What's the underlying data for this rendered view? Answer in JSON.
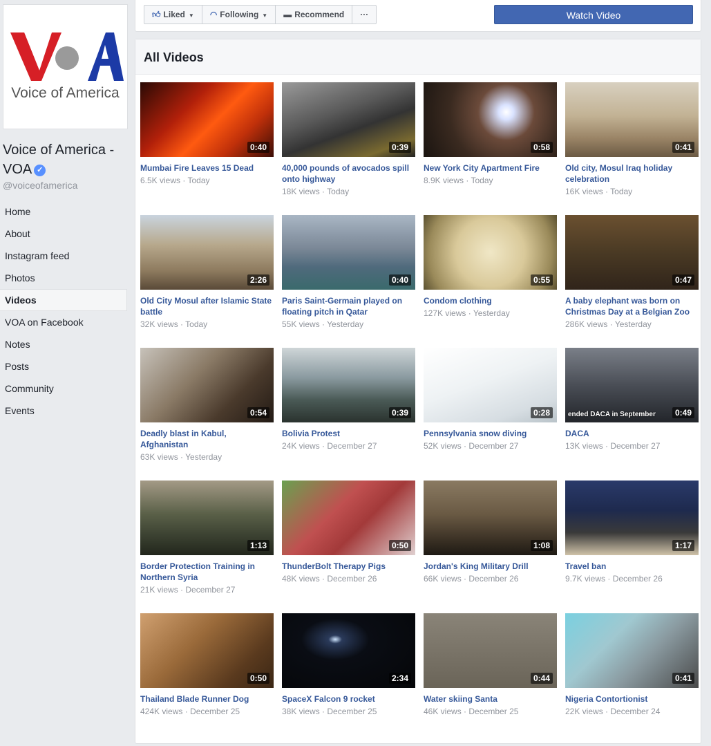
{
  "sidebar": {
    "logo_text": "Voice of America",
    "page_name": "Voice of America - VOA",
    "handle": "@voiceofamerica",
    "nav": [
      {
        "label": "Home"
      },
      {
        "label": "About"
      },
      {
        "label": "Instagram feed"
      },
      {
        "label": "Photos"
      },
      {
        "label": "Videos",
        "active": true
      },
      {
        "label": "VOA on Facebook"
      },
      {
        "label": "Notes"
      },
      {
        "label": "Posts"
      },
      {
        "label": "Community"
      },
      {
        "label": "Events"
      }
    ]
  },
  "toolbar": {
    "liked": "Liked",
    "following": "Following",
    "recommend": "Recommend",
    "more": "···",
    "watch": "Watch Video"
  },
  "panel": {
    "title": "All Videos"
  },
  "colors": {
    "accent": "#4267b2",
    "link": "#365899",
    "meta": "#90949c"
  },
  "videos": [
    {
      "title": "Mumbai Fire Leaves 15 Dead",
      "views": "6.5K views",
      "time": "Today",
      "duration": "0:40",
      "bg": "linear-gradient(135deg,#2a0a05 0%,#b2200a 35%,#ff5a10 55%,#c0300a 75%,#3a0c06 100%)"
    },
    {
      "title": "40,000 pounds of avocados spill onto highway",
      "views": "18K views",
      "time": "Today",
      "duration": "0:39",
      "bg": "linear-gradient(160deg,#9a9a9a 0%,#5a5a5a 40%,#333 60%,#7a6a30 85%,#222 100%)"
    },
    {
      "title": "New York City Apartment Fire",
      "views": "8.9K views",
      "time": "Today",
      "duration": "0:58",
      "bg": "radial-gradient(circle at 62% 40%,#ffffff 0%,#d9e2ff 8%,#6b4a3a 30%,#3a2a20 60%,#1a1410 100%)"
    },
    {
      "title": "Old city, Mosul Iraq holiday celebration",
      "views": "16K views",
      "time": "Today",
      "duration": "0:41",
      "bg": "linear-gradient(180deg,#d8d0c0 0%,#c2b294 45%,#9a8466 75%,#6b5a44 100%)"
    },
    {
      "title": "Old City Mosul after Islamic State battle",
      "views": "32K views",
      "time": "Today",
      "duration": "2:26",
      "bg": "linear-gradient(180deg,#c9d4de 0%,#b7a88c 40%,#8d7a5e 75%,#5a4a38 100%)"
    },
    {
      "title": "Paris Saint-Germain played on floating pitch in Qatar",
      "views": "55K views",
      "time": "Yesterday",
      "duration": "0:40",
      "bg": "linear-gradient(180deg,#a9b6c4 0%,#7a8796 45%,#4f6a7c 70%,#3a6a6c 100%)"
    },
    {
      "title": "Condom clothing",
      "views": "127K views",
      "time": "Yesterday",
      "duration": "0:55",
      "bg": "radial-gradient(circle at 50% 50%,#f0e7c6 0%,#d9c99a 45%,#9a8a5a 80%,#5a5030 100%)"
    },
    {
      "title": "A baby elephant was born on Christmas Day at a Belgian Zoo",
      "views": "286K views",
      "time": "Yesterday",
      "duration": "0:47",
      "bg": "linear-gradient(180deg,#6b5030 0%,#4a3a24 50%,#30241a 100%)"
    },
    {
      "title": "Deadly blast in Kabul, Afghanistan",
      "views": "63K views",
      "time": "Yesterday",
      "duration": "0:54",
      "bg": "linear-gradient(135deg,#c7c2ba 0%,#8a7a66 40%,#4a3a2c 70%,#221a14 100%)"
    },
    {
      "title": "Bolivia Protest",
      "views": "24K views",
      "time": "December 27",
      "duration": "0:39",
      "bg": "linear-gradient(180deg,#cfd6d8 0%,#8a9aa0 40%,#4a5a56 70%,#2a322e 100%)"
    },
    {
      "title": "Pennsylvania snow diving",
      "views": "52K views",
      "time": "December 27",
      "duration": "0:28",
      "bg": "linear-gradient(160deg,#ffffff 0%,#eef2f4 45%,#d6dde2 80%,#b9c3c9 100%)"
    },
    {
      "title": "DACA",
      "views": "13K views",
      "time": "December 27",
      "duration": "0:49",
      "bg": "linear-gradient(180deg,#7a7f88 0%,#4a4e56 50%,#22252a 100%)",
      "overlay": "ended DACA in September"
    },
    {
      "title": "Border Protection Training in Northern Syria",
      "views": "21K views",
      "time": "December 27",
      "duration": "1:13",
      "bg": "linear-gradient(180deg,#a49a86 0%,#5a6048 45%,#3a4030 75%,#22261c 100%)"
    },
    {
      "title": "ThunderBolt Therapy Pigs",
      "views": "48K views",
      "time": "December 26",
      "duration": "0:50",
      "bg": "linear-gradient(135deg,#6aa050 0%,#c05050 40%,#a33a3a 60%,#e0d0d0 100%)"
    },
    {
      "title": "Jordan's King Military Drill",
      "views": "66K views",
      "time": "December 26",
      "duration": "1:08",
      "bg": "linear-gradient(180deg,#8a7a62 0%,#6a5a44 45%,#3a3024 80%,#1e1a14 100%)"
    },
    {
      "title": "Travel ban",
      "views": "9.7K views",
      "time": "December 26",
      "duration": "1:17",
      "bg": "linear-gradient(180deg,#2a3a6a 0%,#1e2a4e 40%,#3a3a3a 70%,#cfc2a8 100%)"
    },
    {
      "title": "Thailand Blade Runner Dog",
      "views": "424K views",
      "time": "December 25",
      "duration": "0:50",
      "bg": "linear-gradient(135deg,#d0a070 0%,#9a6a3a 40%,#5a3a1e 75%,#3a2614 100%)"
    },
    {
      "title": "SpaceX Falcon 9 rocket",
      "views": "38K views",
      "time": "December 25",
      "duration": "2:34",
      "bg": "radial-gradient(ellipse at 40% 35%,#cfe6ff 0%,#2a3a5a 6%,#0a0d14 30%,#050608 100%)"
    },
    {
      "title": "Water skiing Santa",
      "views": "46K views",
      "time": "December 25",
      "duration": "0:44",
      "bg": "linear-gradient(180deg,#8a8478 0%,#7a7468 50%,#6a6458 100%)"
    },
    {
      "title": "Nigeria Contortionist",
      "views": "22K views",
      "time": "December 24",
      "duration": "0:41",
      "bg": "linear-gradient(135deg,#7ad0e0 0%,#a0c8d0 35%,#8a9aa0 60%,#4a4a4a 100%)"
    }
  ]
}
